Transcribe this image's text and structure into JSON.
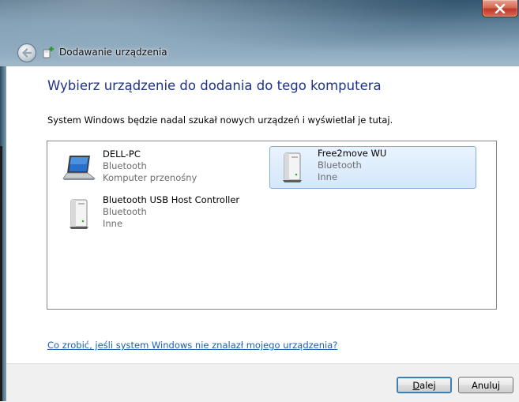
{
  "window": {
    "title": "Dodawanie urządzenia",
    "close_icon": "close-icon",
    "back_icon": "back-arrow-icon"
  },
  "content": {
    "heading": "Wybierz urządzenie do dodania do tego komputera",
    "subtext": "System Windows będzie nadal szukał nowych urządzeń i wyświetlał je tutaj."
  },
  "devices": [
    {
      "name": "DELL-PC",
      "type": "Bluetooth",
      "category": "Komputer przenośny",
      "icon": "laptop-icon",
      "selected": false
    },
    {
      "name": "Free2move WU",
      "type": "Bluetooth",
      "category": "Inne",
      "icon": "generic-device-icon",
      "selected": true
    },
    {
      "name": "Bluetooth USB Host Controller",
      "type": "Bluetooth",
      "category": "Inne",
      "icon": "generic-device-icon",
      "selected": false
    }
  ],
  "help_link": "Co zrobić, jeśli system Windows nie znalazł mojego urządzenia?",
  "buttons": {
    "next_accel": "D",
    "next_rest": "alej",
    "cancel": "Anuluj"
  },
  "colors": {
    "heading": "#1e3287",
    "link": "#1b5fb2",
    "selection": "#d4e7fb"
  }
}
